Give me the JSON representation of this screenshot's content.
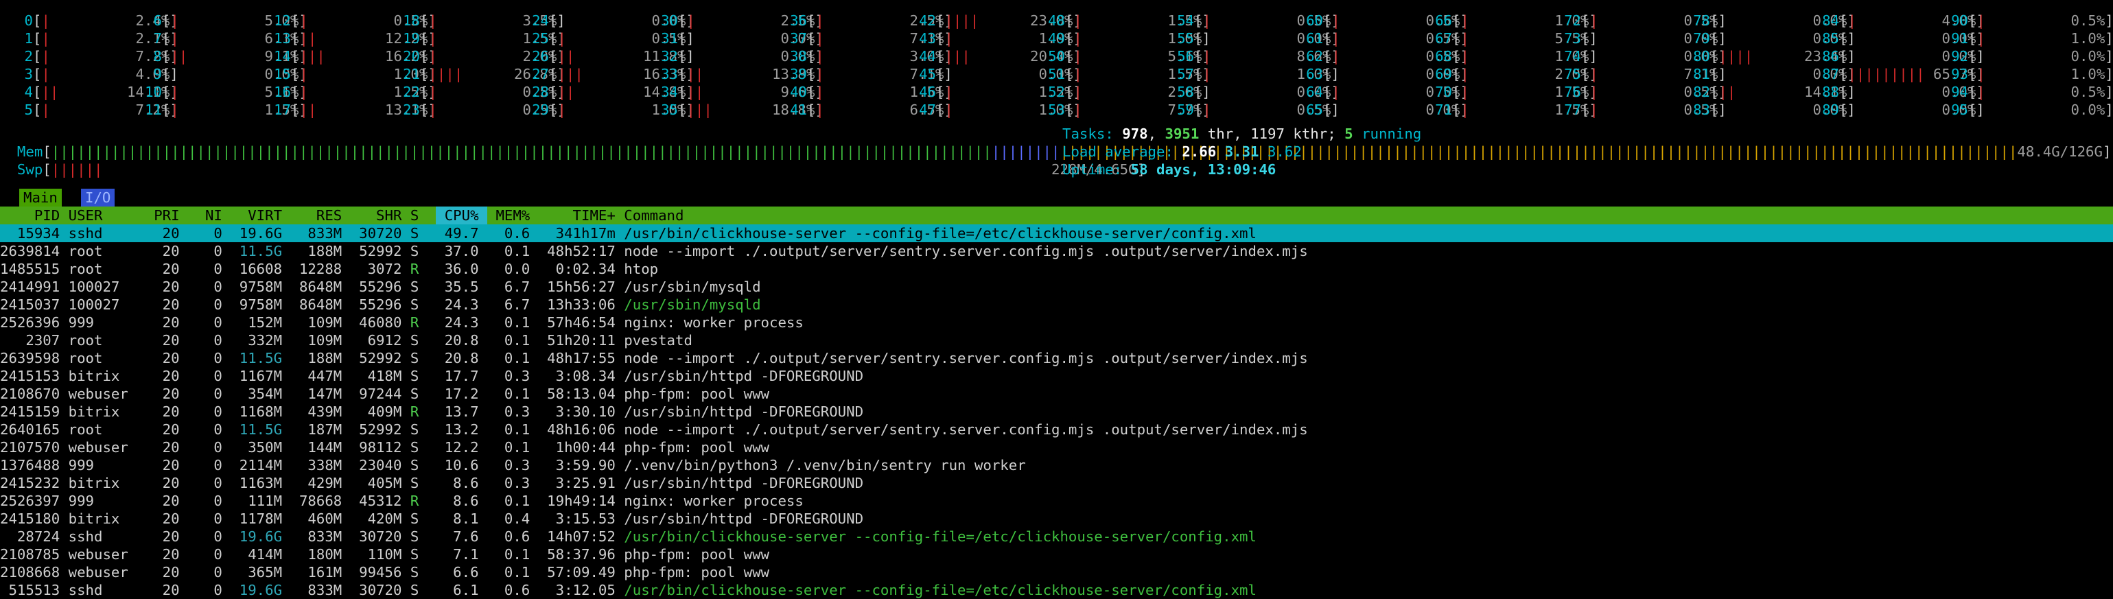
{
  "cpu_columns": [
    [
      [
        "0",
        "2.4%"
      ],
      [
        "1",
        "2.1%"
      ],
      [
        "2",
        "7.2%"
      ],
      [
        "3",
        "4.0%"
      ],
      [
        "4",
        "14.1%"
      ],
      [
        "5",
        "7.2%"
      ]
    ],
    [
      [
        "6",
        "5.0%"
      ],
      [
        "7",
        "6.1%"
      ],
      [
        "8",
        "9.1%"
      ],
      [
        "9",
        "0.0%"
      ],
      [
        "10",
        "5.1%"
      ],
      [
        "11",
        "1.5%"
      ]
    ],
    [
      [
        "12",
        "0.5%"
      ],
      [
        "13",
        "12.2%"
      ],
      [
        "14",
        "16.2%"
      ],
      [
        "15",
        "1.0%"
      ],
      [
        "16",
        "1.5%"
      ],
      [
        "17",
        "13.1%"
      ]
    ],
    [
      [
        "18",
        "3.5%"
      ],
      [
        "19",
        "1.5%"
      ],
      [
        "20",
        "2.0%"
      ],
      [
        "21",
        "26.8%"
      ],
      [
        "22",
        "0.5%"
      ],
      [
        "23",
        "0.5%"
      ]
    ],
    [
      [
        "24",
        "0.0%"
      ],
      [
        "25",
        "0.5%"
      ],
      [
        "26",
        "11.8%"
      ],
      [
        "27",
        "16.3%"
      ],
      [
        "28",
        "14.8%"
      ],
      [
        "29",
        "1.0%"
      ]
    ],
    [
      [
        "30",
        "2.5%"
      ],
      [
        "31",
        "0.0%"
      ],
      [
        "32",
        "0.0%"
      ],
      [
        "33",
        "13.8%"
      ],
      [
        "34",
        "9.6%"
      ],
      [
        "35",
        "18.8%"
      ]
    ],
    [
      [
        "36",
        "2.5%"
      ],
      [
        "37",
        "7.1%"
      ],
      [
        "38",
        "3.0%"
      ],
      [
        "39",
        "7.1%"
      ],
      [
        "40",
        "1.5%"
      ],
      [
        "41",
        "6.5%"
      ]
    ],
    [
      [
        "42",
        "23.0%"
      ],
      [
        "43",
        "1.0%"
      ],
      [
        "44",
        "20.4%"
      ],
      [
        "45",
        "0.0%"
      ],
      [
        "46",
        "1.5%"
      ],
      [
        "47",
        "1.0%"
      ]
    ],
    [
      [
        "48",
        "1.5%"
      ],
      [
        "49",
        "1.0%"
      ],
      [
        "50",
        "5.1%"
      ],
      [
        "51",
        "1.5%"
      ],
      [
        "52",
        "2.6%"
      ],
      [
        "53",
        "7.7%"
      ]
    ],
    [
      [
        "54",
        "0.5%"
      ],
      [
        "55",
        "0.0%"
      ],
      [
        "56",
        "8.6%"
      ],
      [
        "57",
        "1.0%"
      ],
      [
        "58",
        "0.0%"
      ],
      [
        "59",
        "0.5%"
      ]
    ],
    [
      [
        "60",
        "0.5%"
      ],
      [
        "61",
        "0.5%"
      ],
      [
        "62",
        "0.5%"
      ],
      [
        "63",
        "0.0%"
      ],
      [
        "64",
        "0.5%"
      ],
      [
        "65",
        "0.0%"
      ]
    ],
    [
      [
        "66",
        "1.0%"
      ],
      [
        "67",
        "5.5%"
      ],
      [
        "68",
        "1.0%"
      ],
      [
        "69",
        "2.0%"
      ],
      [
        "70",
        "1.5%"
      ],
      [
        "71",
        "1.5%"
      ]
    ],
    [
      [
        "72",
        "0.5%"
      ],
      [
        "73",
        "0.0%"
      ],
      [
        "74",
        "0.0%"
      ],
      [
        "75",
        "7.1%"
      ],
      [
        "76",
        "0.5%"
      ],
      [
        "77",
        "0.5%"
      ]
    ],
    [
      [
        "78",
        "0.0%"
      ],
      [
        "79",
        "0.0%"
      ],
      [
        "80",
        "23.4%"
      ],
      [
        "81",
        "0.0%"
      ],
      [
        "82",
        "14.1%"
      ],
      [
        "83",
        "0.0%"
      ]
    ],
    [
      [
        "84",
        "4.0%"
      ],
      [
        "85",
        "0.0%"
      ],
      [
        "86",
        "0.0%"
      ],
      [
        "87",
        "65.7%"
      ],
      [
        "88",
        "0.0%"
      ],
      [
        "89",
        "0.0%"
      ]
    ],
    [
      [
        "90",
        "0.5%"
      ],
      [
        "91",
        "1.0%"
      ],
      [
        "92",
        "0.0%"
      ],
      [
        "93",
        "1.0%"
      ],
      [
        "94",
        "0.5%"
      ],
      [
        "95",
        "0.0%"
      ]
    ]
  ],
  "mem": {
    "label": "Mem",
    "value": "48.4G/126G"
  },
  "swp": {
    "label": "Swp",
    "value": "228M/4.65G"
  },
  "tasks": {
    "label": "Tasks:",
    "count": "978",
    "thr_count": "3951",
    "thr_label": "thr,",
    "kthr": "1197 kthr;",
    "running_count": "5",
    "running_label": "running"
  },
  "load": {
    "label": "Load average:",
    "l1": "2.66",
    "l5": "3.31",
    "l15": "3.62"
  },
  "uptime": {
    "label": "Uptime:",
    "value": "58 days, 13:09:46"
  },
  "tabs": [
    {
      "label": "Main"
    },
    {
      "label": "I/O"
    }
  ],
  "columns": [
    "PID",
    "USER",
    "PRI",
    "NI",
    "VIRT",
    "RES",
    "SHR",
    "S",
    "CPU%",
    "MEM%",
    "TIME+",
    "Command"
  ],
  "processes": [
    [
      "15934",
      "sshd",
      "20",
      "0",
      "19.6G",
      "833M",
      "30720",
      "S",
      "49.7",
      "0.6",
      "341h17m",
      "/usr/bin/clickhouse-server --config-file=/etc/clickhouse-server/config.xml"
    ],
    [
      "2639814",
      "root",
      "20",
      "0",
      "11.5G",
      "188M",
      "52992",
      "S",
      "37.0",
      "0.1",
      "48h52:17",
      "node --import ./.output/server/sentry.server.config.mjs .output/server/index.mjs"
    ],
    [
      "1485515",
      "root",
      "20",
      "0",
      "16608",
      "12288",
      "3072",
      "R",
      "36.0",
      "0.0",
      "0:02.34",
      "htop"
    ],
    [
      "2414991",
      "100027",
      "20",
      "0",
      "9758M",
      "8648M",
      "55296",
      "S",
      "35.5",
      "6.7",
      "15h56:27",
      "/usr/sbin/mysqld"
    ],
    [
      "2415037",
      "100027",
      "20",
      "0",
      "9758M",
      "8648M",
      "55296",
      "S",
      "24.3",
      "6.7",
      "13h33:06",
      "/usr/sbin/mysqld"
    ],
    [
      "2526396",
      "999",
      "20",
      "0",
      "152M",
      "109M",
      "46080",
      "R",
      "24.3",
      "0.1",
      "57h46:54",
      "nginx: worker process"
    ],
    [
      "2307",
      "root",
      "20",
      "0",
      "332M",
      "109M",
      "6912",
      "S",
      "20.8",
      "0.1",
      "51h20:11",
      "pvestatd"
    ],
    [
      "2639598",
      "root",
      "20",
      "0",
      "11.5G",
      "188M",
      "52992",
      "S",
      "20.8",
      "0.1",
      "48h17:55",
      "node --import ./.output/server/sentry.server.config.mjs .output/server/index.mjs"
    ],
    [
      "2415153",
      "bitrix",
      "20",
      "0",
      "1167M",
      "447M",
      "418M",
      "S",
      "17.7",
      "0.3",
      "3:08.34",
      "/usr/sbin/httpd -DFOREGROUND"
    ],
    [
      "2108670",
      "webuser",
      "20",
      "0",
      "354M",
      "147M",
      "97244",
      "S",
      "17.2",
      "0.1",
      "58:13.04",
      "php-fpm: pool www"
    ],
    [
      "2415159",
      "bitrix",
      "20",
      "0",
      "1168M",
      "439M",
      "409M",
      "R",
      "13.7",
      "0.3",
      "3:30.10",
      "/usr/sbin/httpd -DFOREGROUND"
    ],
    [
      "2640165",
      "root",
      "20",
      "0",
      "11.5G",
      "187M",
      "52992",
      "S",
      "13.2",
      "0.1",
      "48h16:06",
      "node --import ./.output/server/sentry.server.config.mjs .output/server/index.mjs"
    ],
    [
      "2107570",
      "webuser",
      "20",
      "0",
      "350M",
      "144M",
      "98112",
      "S",
      "12.2",
      "0.1",
      "1h00:44",
      "php-fpm: pool www"
    ],
    [
      "1376488",
      "999",
      "20",
      "0",
      "2114M",
      "338M",
      "23040",
      "S",
      "10.6",
      "0.3",
      "3:59.90",
      "/.venv/bin/python3 /.venv/bin/sentry run worker"
    ],
    [
      "2415232",
      "bitrix",
      "20",
      "0",
      "1163M",
      "429M",
      "405M",
      "S",
      "8.6",
      "0.3",
      "3:25.91",
      "/usr/sbin/httpd -DFOREGROUND"
    ],
    [
      "2526397",
      "999",
      "20",
      "0",
      "111M",
      "78668",
      "45312",
      "R",
      "8.6",
      "0.1",
      "19h49:14",
      "nginx: worker process"
    ],
    [
      "2415180",
      "bitrix",
      "20",
      "0",
      "1178M",
      "460M",
      "420M",
      "S",
      "8.1",
      "0.4",
      "3:15.53",
      "/usr/sbin/httpd -DFOREGROUND"
    ],
    [
      "28724",
      "sshd",
      "20",
      "0",
      "19.6G",
      "833M",
      "30720",
      "S",
      "7.6",
      "0.6",
      "14h07:52",
      "/usr/bin/clickhouse-server --config-file=/etc/clickhouse-server/config.xml"
    ],
    [
      "2108785",
      "webuser",
      "20",
      "0",
      "414M",
      "180M",
      "110M",
      "S",
      "7.1",
      "0.1",
      "58:37.96",
      "php-fpm: pool www"
    ],
    [
      "2108668",
      "webuser",
      "20",
      "0",
      "365M",
      "161M",
      "99456",
      "S",
      "6.6",
      "0.1",
      "57:09.49",
      "php-fpm: pool www"
    ],
    [
      "515513",
      "sshd",
      "20",
      "0",
      "19.6G",
      "833M",
      "30720",
      "S",
      "6.1",
      "0.6",
      "3:12.05",
      "/usr/bin/clickhouse-server --config-file=/etc/clickhouse-server/config.xml"
    ]
  ],
  "colors": {
    "green": "#46a000",
    "cyan": "#06a9b7",
    "blue": "#3050d0",
    "red": "#d62b2b",
    "yellow": "#d7a400"
  }
}
